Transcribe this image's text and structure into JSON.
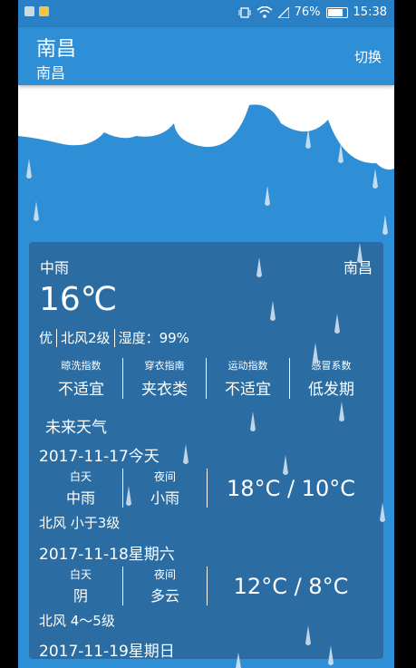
{
  "status_bar": {
    "battery": "76%",
    "time": "15:38"
  },
  "app_bar": {
    "title": "南昌",
    "subtitle": "南昌",
    "switch_label": "切换"
  },
  "current": {
    "condition": "中雨",
    "city": "南昌",
    "temperature": "16℃",
    "aqi": "优",
    "wind": "北风2级",
    "humidity": "湿度：99%"
  },
  "indices": [
    {
      "name": "晾洗指数",
      "value": "不适宜"
    },
    {
      "name": "穿衣指南",
      "value": "夹衣类"
    },
    {
      "name": "运动指数",
      "value": "不适宜"
    },
    {
      "name": "感冒系数",
      "value": "低发期"
    }
  ],
  "future": {
    "heading": "未来天气",
    "day_label": "白天",
    "night_label": "夜间",
    "days": [
      {
        "date": "2017-11-17今天",
        "day_weather": "中雨",
        "night_weather": "小雨",
        "range": "18°C / 10°C",
        "wind": "北风 小于3级"
      },
      {
        "date": "2017-11-18星期六",
        "day_weather": "阴",
        "night_weather": "多云",
        "range": "12°C / 8°C",
        "wind": "北风 4～5级"
      },
      {
        "date": "2017-11-19星期日"
      }
    ]
  },
  "colors": {
    "sky": "#2f8fd6",
    "card": "#2b6da3",
    "status_bar": "#2a80c4",
    "cloud": "#ffffff"
  }
}
